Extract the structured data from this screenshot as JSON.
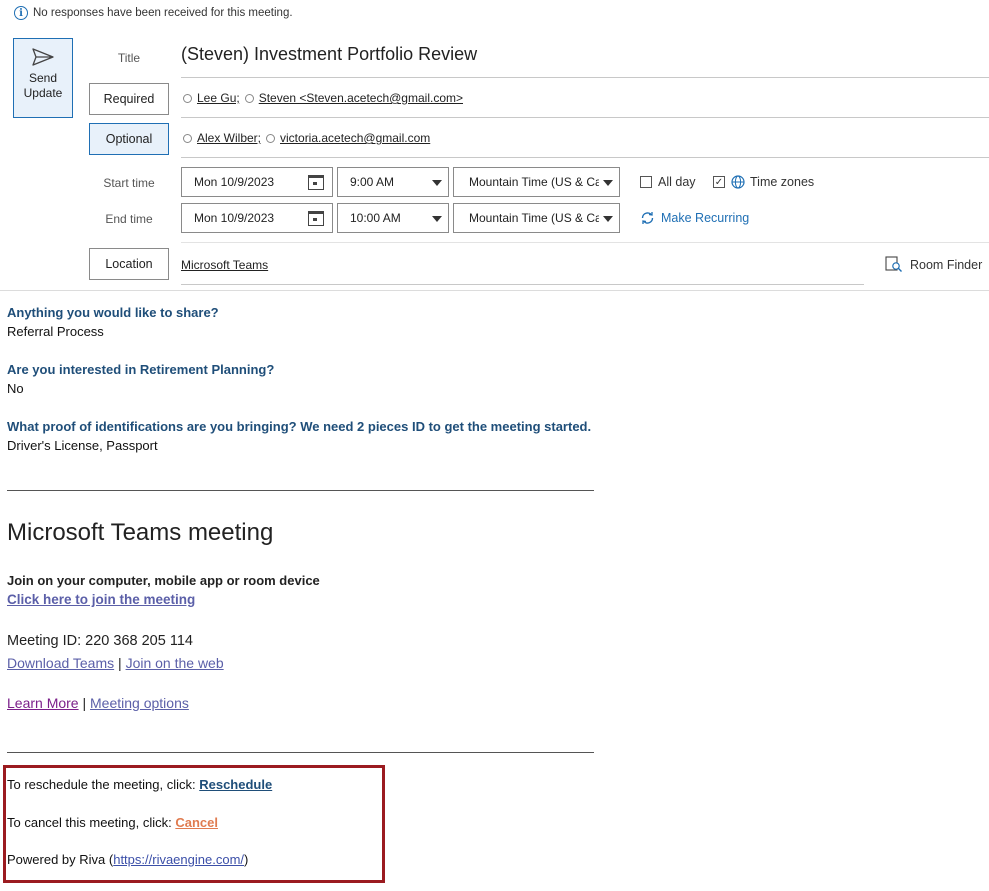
{
  "info_bar": {
    "text": "No responses have been received for this meeting."
  },
  "send_button": {
    "line1": "Send",
    "line2": "Update"
  },
  "fields": {
    "title_label": "Title",
    "title_value": "(Steven) Investment Portfolio Review",
    "required_label": "Required",
    "required_attendees": [
      "Lee Gu;",
      "Steven <Steven.acetech@gmail.com>"
    ],
    "optional_label": "Optional",
    "optional_attendees": [
      "Alex Wilber;",
      "victoria.acetech@gmail.com"
    ],
    "start_label": "Start time",
    "end_label": "End time",
    "start_date": "Mon 10/9/2023",
    "start_time": "9:00 AM",
    "end_date": "Mon 10/9/2023",
    "end_time": "10:00 AM",
    "timezone": "Mountain Time (US & Canada)",
    "all_day_label": "All day",
    "all_day_checked": false,
    "time_zones_label": "Time zones",
    "time_zones_checked": true,
    "make_recurring_label": "Make Recurring",
    "location_label": "Location",
    "location_value": "Microsoft Teams",
    "room_finder_label": "Room Finder"
  },
  "body": {
    "q1": "Anything you would like to share?",
    "a1": "Referral Process",
    "q2": "Are you interested in Retirement Planning?",
    "a2": "No",
    "q3": "What proof of identifications are you bringing? We need 2 pieces ID to get the meeting started.",
    "a3": "Driver's License, Passport",
    "teams_heading": "Microsoft Teams meeting",
    "join_heading": "Join on your computer, mobile app or room device",
    "join_link": "Click here to join the meeting",
    "meeting_id": "Meeting ID: 220 368 205 114",
    "download_teams": "Download Teams",
    "pipe": "|",
    "join_web": "Join on the web",
    "learn_more": "Learn More",
    "meeting_options": "Meeting options",
    "reschedule_text": "To reschedule the meeting, click: ",
    "reschedule_link": "Reschedule",
    "cancel_text": "To cancel this meeting, click: ",
    "cancel_link": "Cancel",
    "powered_prefix": "Powered by Riva (",
    "powered_link": "https://rivaengine.com/",
    "powered_suffix": ")"
  },
  "colors": {
    "accent": "#1f6fb4",
    "question": "#1f4e79",
    "link": "#5b5fa8",
    "visited_link": "#7b1f8a",
    "reschedule": "#1f4e79",
    "cancel": "#e07b4f",
    "highlight_box": "#9b1b20"
  }
}
